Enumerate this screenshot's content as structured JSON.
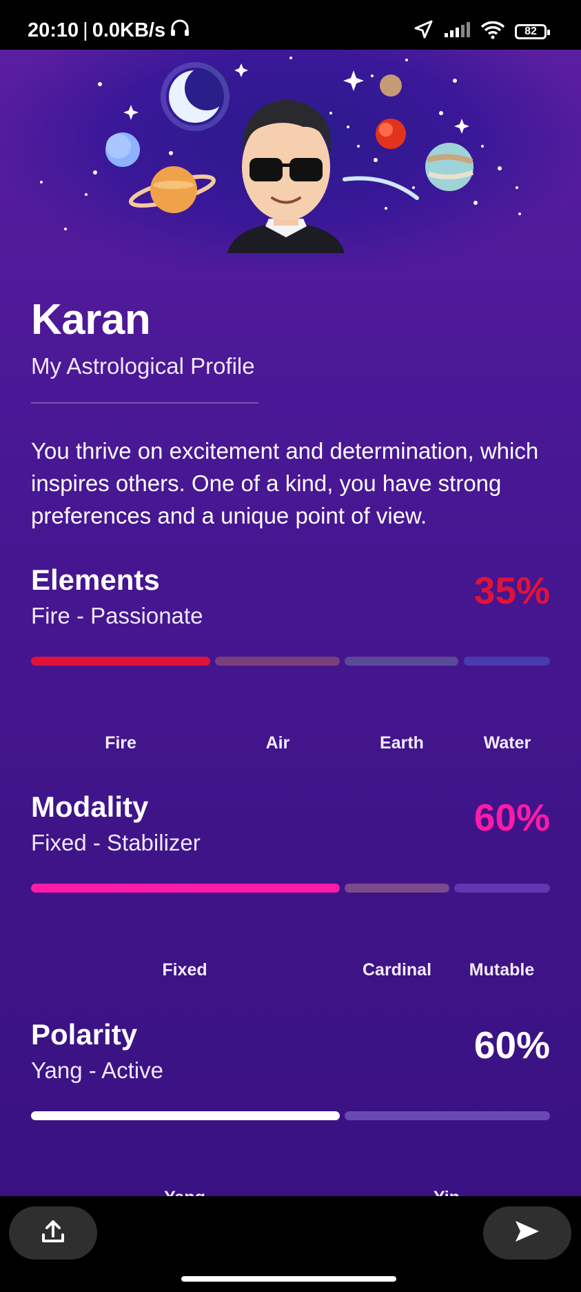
{
  "status": {
    "time": "20:10",
    "separator": "|",
    "network_speed": "0.0KB/s",
    "battery": "82",
    "icons": [
      "headphones-icon",
      "location-arrow-icon",
      "signal-icon",
      "wifi-icon",
      "battery-icon"
    ]
  },
  "profile": {
    "name": "Karan",
    "subtitle": "My Astrological Profile",
    "description": "You thrive on excitement and determination, which inspires others. One of a kind, you have strong preferences and a unique point of view."
  },
  "sections": {
    "elements": {
      "title": "Elements",
      "subtitle": "Fire - Passionate",
      "percent": "35%",
      "accent": "#e0123a",
      "segments": [
        {
          "label": "Fire",
          "share": 0.35,
          "color": "#e0123a"
        },
        {
          "label": "Air",
          "share": 0.25,
          "color": "#7a3f7a"
        },
        {
          "label": "Earth",
          "share": 0.22,
          "color": "#5a4a9a"
        },
        {
          "label": "Water",
          "share": 0.17,
          "color": "#4a3aaf"
        }
      ]
    },
    "modality": {
      "title": "Modality",
      "subtitle": "Fixed - Stabilizer",
      "percent": "60%",
      "accent": "#ff1aa8",
      "segments": [
        {
          "label": "Fixed",
          "share": 0.6,
          "color": "#ff1aa8"
        },
        {
          "label": "Cardinal",
          "share": 0.21,
          "color": "#7a4a8a"
        },
        {
          "label": "Mutable",
          "share": 0.19,
          "color": "#6236b0"
        }
      ]
    },
    "polarity": {
      "title": "Polarity",
      "subtitle": "Yang - Active",
      "percent": "60%",
      "accent": "#ffffff",
      "segments": [
        {
          "label": "Yang",
          "share": 0.6,
          "color": "#ffffff"
        },
        {
          "label": "Yin",
          "share": 0.4,
          "color": "#6a48b4"
        }
      ]
    }
  },
  "bottom": {
    "share_icon": "upload-icon",
    "send_icon": "send-icon"
  }
}
